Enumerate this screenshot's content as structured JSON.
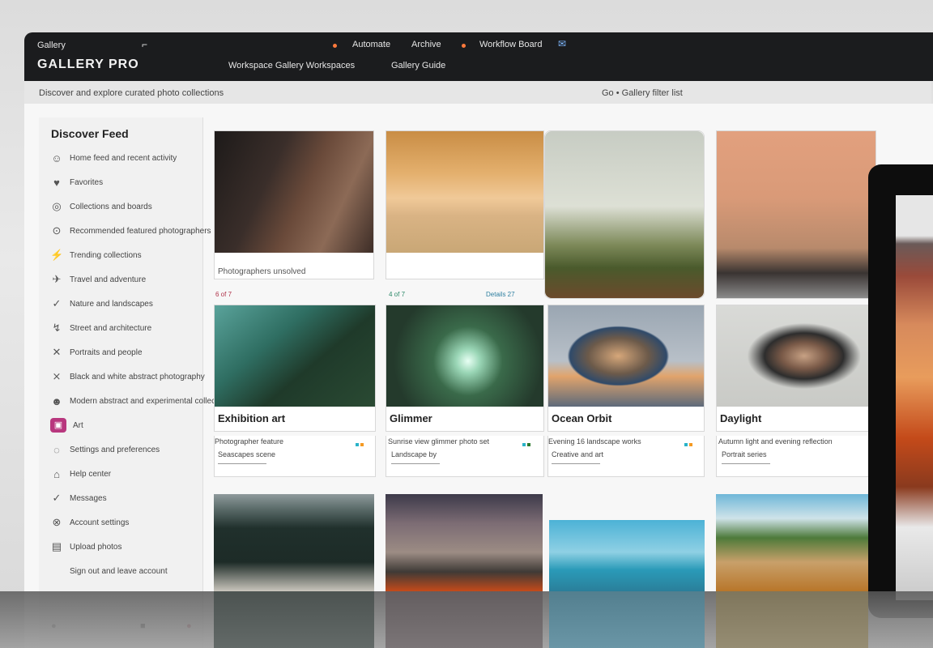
{
  "header": {
    "title_left": "Gallery",
    "brand": "GALLERY PRO",
    "nav_primary": [
      "Automate",
      "Archive",
      "Workflow Board"
    ],
    "nav_secondary": [
      "Workspace Gallery Workspaces",
      "Gallery Guide"
    ]
  },
  "subbar": {
    "left": "Discover and explore curated photo collections",
    "right": "Go • Gallery filter list"
  },
  "sidebar": {
    "heading": "Discover Feed",
    "items": [
      {
        "icon": "☺",
        "label": "Home feed and recent activity"
      },
      {
        "icon": "♥",
        "label": "Favorites"
      },
      {
        "icon": "◎",
        "label": "Collections and boards"
      },
      {
        "icon": "⊙",
        "label": "Recommended featured photographers"
      },
      {
        "icon": "⚡",
        "label": "Trending collections"
      },
      {
        "icon": "✈",
        "label": "Travel and adventure"
      },
      {
        "icon": "✓",
        "label": "Nature and landscapes"
      },
      {
        "icon": "↯",
        "label": "Street and architecture"
      },
      {
        "icon": "✕",
        "label": "Portraits and people"
      },
      {
        "icon": "⨯",
        "label": "Black and white abstract photography"
      },
      {
        "icon": "☻",
        "label": "Modern abstract and experimental collections"
      },
      {
        "icon": "▣",
        "label": "Art"
      },
      {
        "icon": "◌",
        "label": "Settings and preferences"
      },
      {
        "icon": "⌂",
        "label": "Help center"
      },
      {
        "icon": "✓",
        "label": "Messages"
      },
      {
        "icon": "⊗",
        "label": "Account settings"
      },
      {
        "icon": "▤",
        "label": "Upload photos"
      },
      {
        "icon": "",
        "label": "Sign out and leave account"
      }
    ]
  },
  "row1": {
    "captions": [
      "Photographers unsolved",
      "",
      "",
      ""
    ],
    "tags": [
      "6 of 7",
      "4 of 7",
      "Details 27",
      ""
    ]
  },
  "row2": {
    "titles": [
      "Exhibition art",
      "Glimmer",
      "Ocean Orbit",
      "Daylight"
    ],
    "meta1": [
      "Photographer feature",
      "Sunrise view glimmer photo set",
      "Evening 16 landscape works",
      "Autumn light and evening reflection"
    ],
    "meta2": [
      "Seascapes scene",
      "Landscape by",
      "Creative and art",
      "Portrait series"
    ]
  },
  "colors": {
    "header_bg": "#1b1c1e",
    "accent": "#ff7a3c",
    "sidebar_bg": "#f1f1f1",
    "pink_badge": "#b8377e"
  }
}
